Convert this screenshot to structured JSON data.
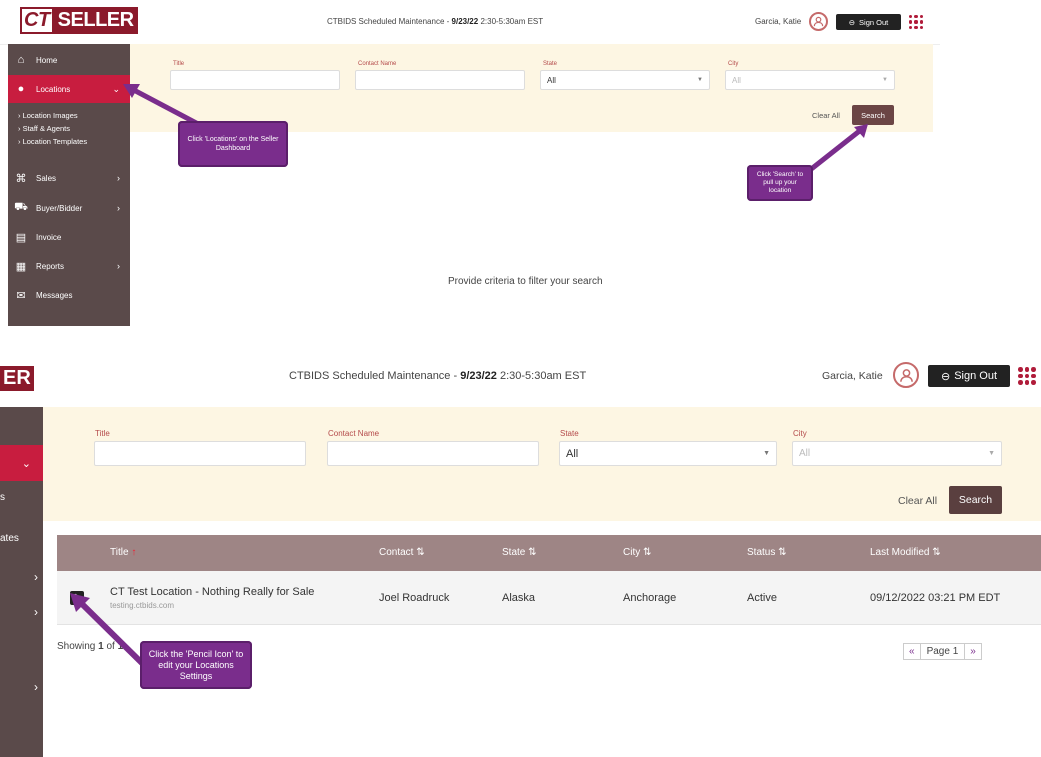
{
  "header": {
    "logo_ct": "CT",
    "logo_seller": "SELLER",
    "maint_prefix": "CTBIDS Scheduled Maintenance - ",
    "maint_date": "9/23/22",
    "maint_time": " 2:30-5:30am EST",
    "user_name": "Garcia, Katie",
    "sign_out": "Sign Out"
  },
  "sidebar": {
    "items": [
      {
        "label": "Home",
        "icon": "home-icon"
      },
      {
        "label": "Locations",
        "icon": "location-pin-icon"
      },
      {
        "label": "Sales",
        "icon": "bank-icon"
      },
      {
        "label": "Buyer/Bidder",
        "icon": "cart-icon"
      },
      {
        "label": "Invoice",
        "icon": "invoice-icon"
      },
      {
        "label": "Reports",
        "icon": "reports-icon"
      },
      {
        "label": "Messages",
        "icon": "envelope-icon"
      }
    ],
    "sub_items": [
      "Location Images",
      "Staff & Agents",
      "Location Templates"
    ]
  },
  "filters": {
    "title_label": "Title",
    "contact_label": "Contact Name",
    "state_label": "State",
    "state_value": "All",
    "city_label": "City",
    "city_value": "All",
    "clear_all": "Clear All",
    "search": "Search"
  },
  "empty_message": "Provide criteria to filter your search",
  "callouts": {
    "locations": "Click 'Locations' on the Seller Dashboard",
    "search": "Click 'Search' to pull up your location",
    "pencil": "Click the 'Pencil Icon' to edit your Locations Settings"
  },
  "bottom": {
    "logo_fragment": "ER",
    "sidebar_fragments": [
      "s",
      "ates"
    ],
    "table": {
      "headers": [
        "Title",
        "Contact",
        "State",
        "City",
        "Status",
        "Last Modified"
      ],
      "row": {
        "title": "CT Test Location - Nothing Really for Sale",
        "subtitle": "testing.ctbids.com",
        "contact": "Joel Roadruck",
        "state": "Alaska",
        "city": "Anchorage",
        "status": "Active",
        "modified": "09/12/2022 03:21 PM EDT"
      }
    },
    "showing_prefix": "Showing ",
    "showing_n": "1",
    "showing_of": " of ",
    "showing_total": "1",
    "page_label": "Page 1",
    "first": "«",
    "last": "»"
  },
  "colors": {
    "brand": "#8b1a2b",
    "sidebar": "#5a4a4a",
    "active": "#c81d3f",
    "callout": "#7a2d8c",
    "table_header": "#9e8585"
  }
}
